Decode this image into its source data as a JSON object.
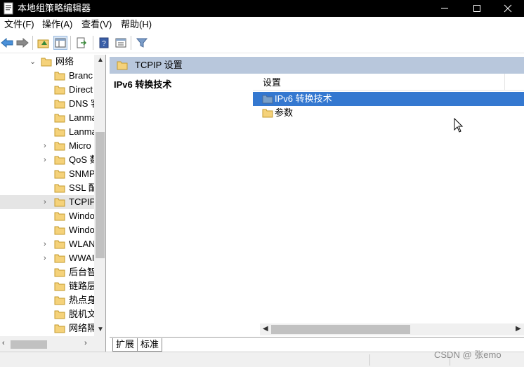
{
  "window": {
    "title": "本地组策略编辑器",
    "controls": {
      "minimize": "—",
      "maximize": "☐",
      "close": "✕"
    }
  },
  "menu": [
    "文件(F)",
    "操作(A)",
    "查看(V)",
    "帮助(H)"
  ],
  "toolbar_icons": [
    "back-arrow-icon",
    "forward-arrow-icon",
    "up-folder-icon",
    "show-hide-tree-icon",
    "export-list-icon",
    "help-icon",
    "properties-icon",
    "filter-icon"
  ],
  "tree": {
    "root": "网络",
    "items": [
      {
        "label": "Branc",
        "expandable": false
      },
      {
        "label": "Direct",
        "expandable": false
      },
      {
        "label": "DNS 客",
        "expandable": false
      },
      {
        "label": "Lanma",
        "expandable": false
      },
      {
        "label": "Lanma",
        "expandable": false
      },
      {
        "label": "Micro",
        "expandable": true
      },
      {
        "label": "QoS 数",
        "expandable": true
      },
      {
        "label": "SNMP",
        "expandable": false
      },
      {
        "label": "SSL 配",
        "expandable": false
      },
      {
        "label": "TCPIP",
        "expandable": true,
        "selected": true
      },
      {
        "label": "Windo",
        "expandable": false
      },
      {
        "label": "Windo",
        "expandable": false
      },
      {
        "label": "WLAN",
        "expandable": true
      },
      {
        "label": "WWAI",
        "expandable": true
      },
      {
        "label": "后台智",
        "expandable": false
      },
      {
        "label": "链路层",
        "expandable": false
      },
      {
        "label": "热点身",
        "expandable": false
      },
      {
        "label": "脱机文",
        "expandable": false
      },
      {
        "label": "网络隔",
        "expandable": false
      }
    ]
  },
  "right": {
    "header": "TCPIP 设置",
    "description_title": "IPv6 转换技术",
    "column_header": "设置",
    "rows": [
      {
        "label": "IPv6 转换技术",
        "selected": true
      },
      {
        "label": "参数",
        "selected": false
      }
    ],
    "tabs": [
      "扩展",
      "标准"
    ]
  },
  "watermark": "CSDN @    张emo",
  "colors": {
    "selection": "#3478d0",
    "header_band": "#b8c7dc",
    "folder": "#f5d27a"
  }
}
